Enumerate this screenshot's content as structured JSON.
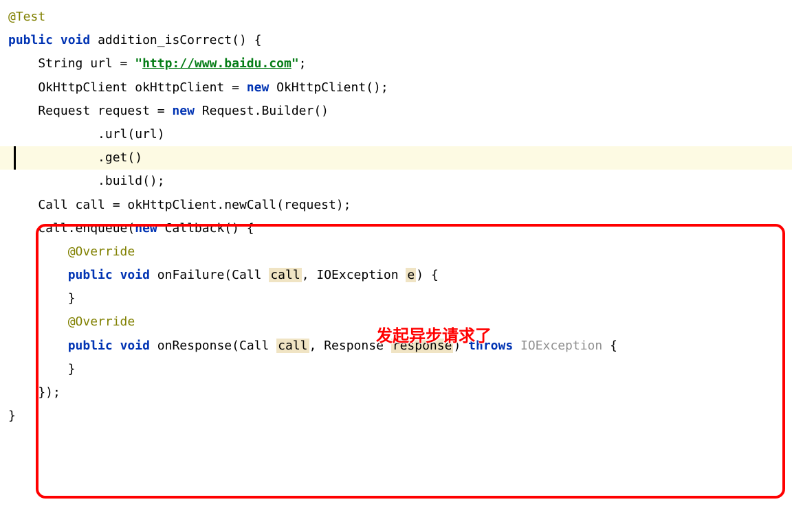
{
  "code": {
    "annotation_test": "@Test",
    "line2": {
      "public": "public",
      "void": "void",
      "method": " addition_isCorrect() {"
    },
    "line3": {
      "pre": "    String url = ",
      "q1": "\"",
      "url": "http://www.baidu.com",
      "q2": "\"",
      "semi": ";"
    },
    "line4": {
      "pre": "    OkHttpClient okHttpClient = ",
      "new": "new",
      "post": " OkHttpClient();"
    },
    "line5": {
      "pre": "    Request request = ",
      "new": "new",
      "post": " Request.Builder()"
    },
    "line6": "            .url(url)",
    "line7": "            .get()",
    "line8": "            .build();",
    "line9": "    Call call = okHttpClient.newCall(request);",
    "line10": {
      "pre": "    call.enqueue(",
      "new": "new",
      "post": " Callback() {"
    },
    "line11": "        @Override",
    "line12": {
      "indent": "        ",
      "public": "public",
      "void": "void",
      "method": " onFailure(Call ",
      "p1": "call",
      "mid": ", IOException ",
      "p2": "e",
      "end": ") {"
    },
    "line13": "",
    "line14": "        }",
    "line15": "",
    "line16": "        @Override",
    "line17": {
      "indent": "        ",
      "public": "public",
      "void": "void",
      "method": " onResponse(Call ",
      "p1": "call",
      "mid": ", Response ",
      "p2": "response",
      "end": ") ",
      "throws": "throws",
      "exc": " IOException ",
      "brace": "{"
    },
    "line18": "",
    "line19": "        }",
    "line20": "    });",
    "line21": "}"
  },
  "annotation_text": "发起异步请求了"
}
